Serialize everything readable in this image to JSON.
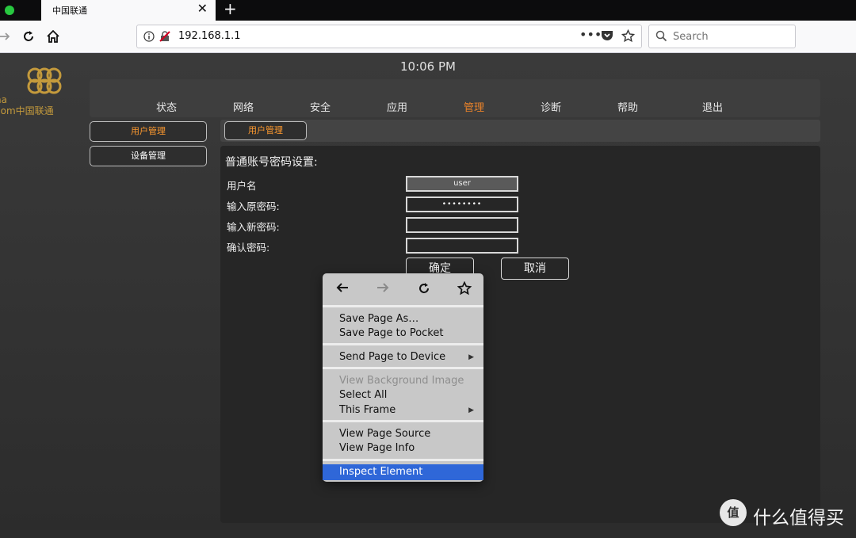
{
  "browser": {
    "tab_title": "中国联通",
    "tab_close": "✕",
    "new_tab": "+",
    "url": "192.168.1.1",
    "search_placeholder": "Search",
    "icons": [
      "forward-icon",
      "reload-icon",
      "home-icon",
      "info-icon",
      "insecure-lock-icon",
      "page-actions-icon",
      "pocket-icon",
      "bookmark-star-icon",
      "search-icon"
    ]
  },
  "page": {
    "time": "10:06 PM",
    "logo_text_1": "na",
    "logo_text_2": "com中国联通",
    "nav": [
      "状态",
      "网络",
      "安全",
      "应用",
      "管理",
      "诊断",
      "帮助",
      "退出"
    ],
    "nav_active": "管理",
    "sidebar": [
      "用户管理",
      "设备管理"
    ],
    "sidebar_active": "用户管理",
    "subtab": "用户管理",
    "form": {
      "heading": "普通账号密码设置:",
      "username_label": "用户名",
      "username_value": "user",
      "old_password_label": "输入原密码:",
      "old_password_value": "••••••••",
      "new_password_label": "输入新密码:",
      "confirm_password_label": "确认密码:",
      "ok_button": "确定",
      "cancel_button": "取消"
    },
    "accent_color": "#ff9a2e"
  },
  "context_menu": {
    "nav_icons": [
      "back-arrow-icon",
      "forward-arrow-icon",
      "reload-icon",
      "bookmark-star-icon"
    ],
    "items": [
      {
        "label": "Save Page As…"
      },
      {
        "label": "Save Page to Pocket"
      },
      {
        "label": "Send Page to Device",
        "submenu": "▶"
      },
      {
        "label": "View Background Image",
        "disabled": true
      },
      {
        "label": "Select All"
      },
      {
        "label": "This Frame",
        "submenu": "▶"
      },
      {
        "label": "View Page Source"
      },
      {
        "label": "View Page Info"
      },
      {
        "label": "Inspect Element",
        "highlighted": true
      }
    ]
  },
  "watermark": {
    "badge": "值",
    "text": "什么值得买"
  }
}
